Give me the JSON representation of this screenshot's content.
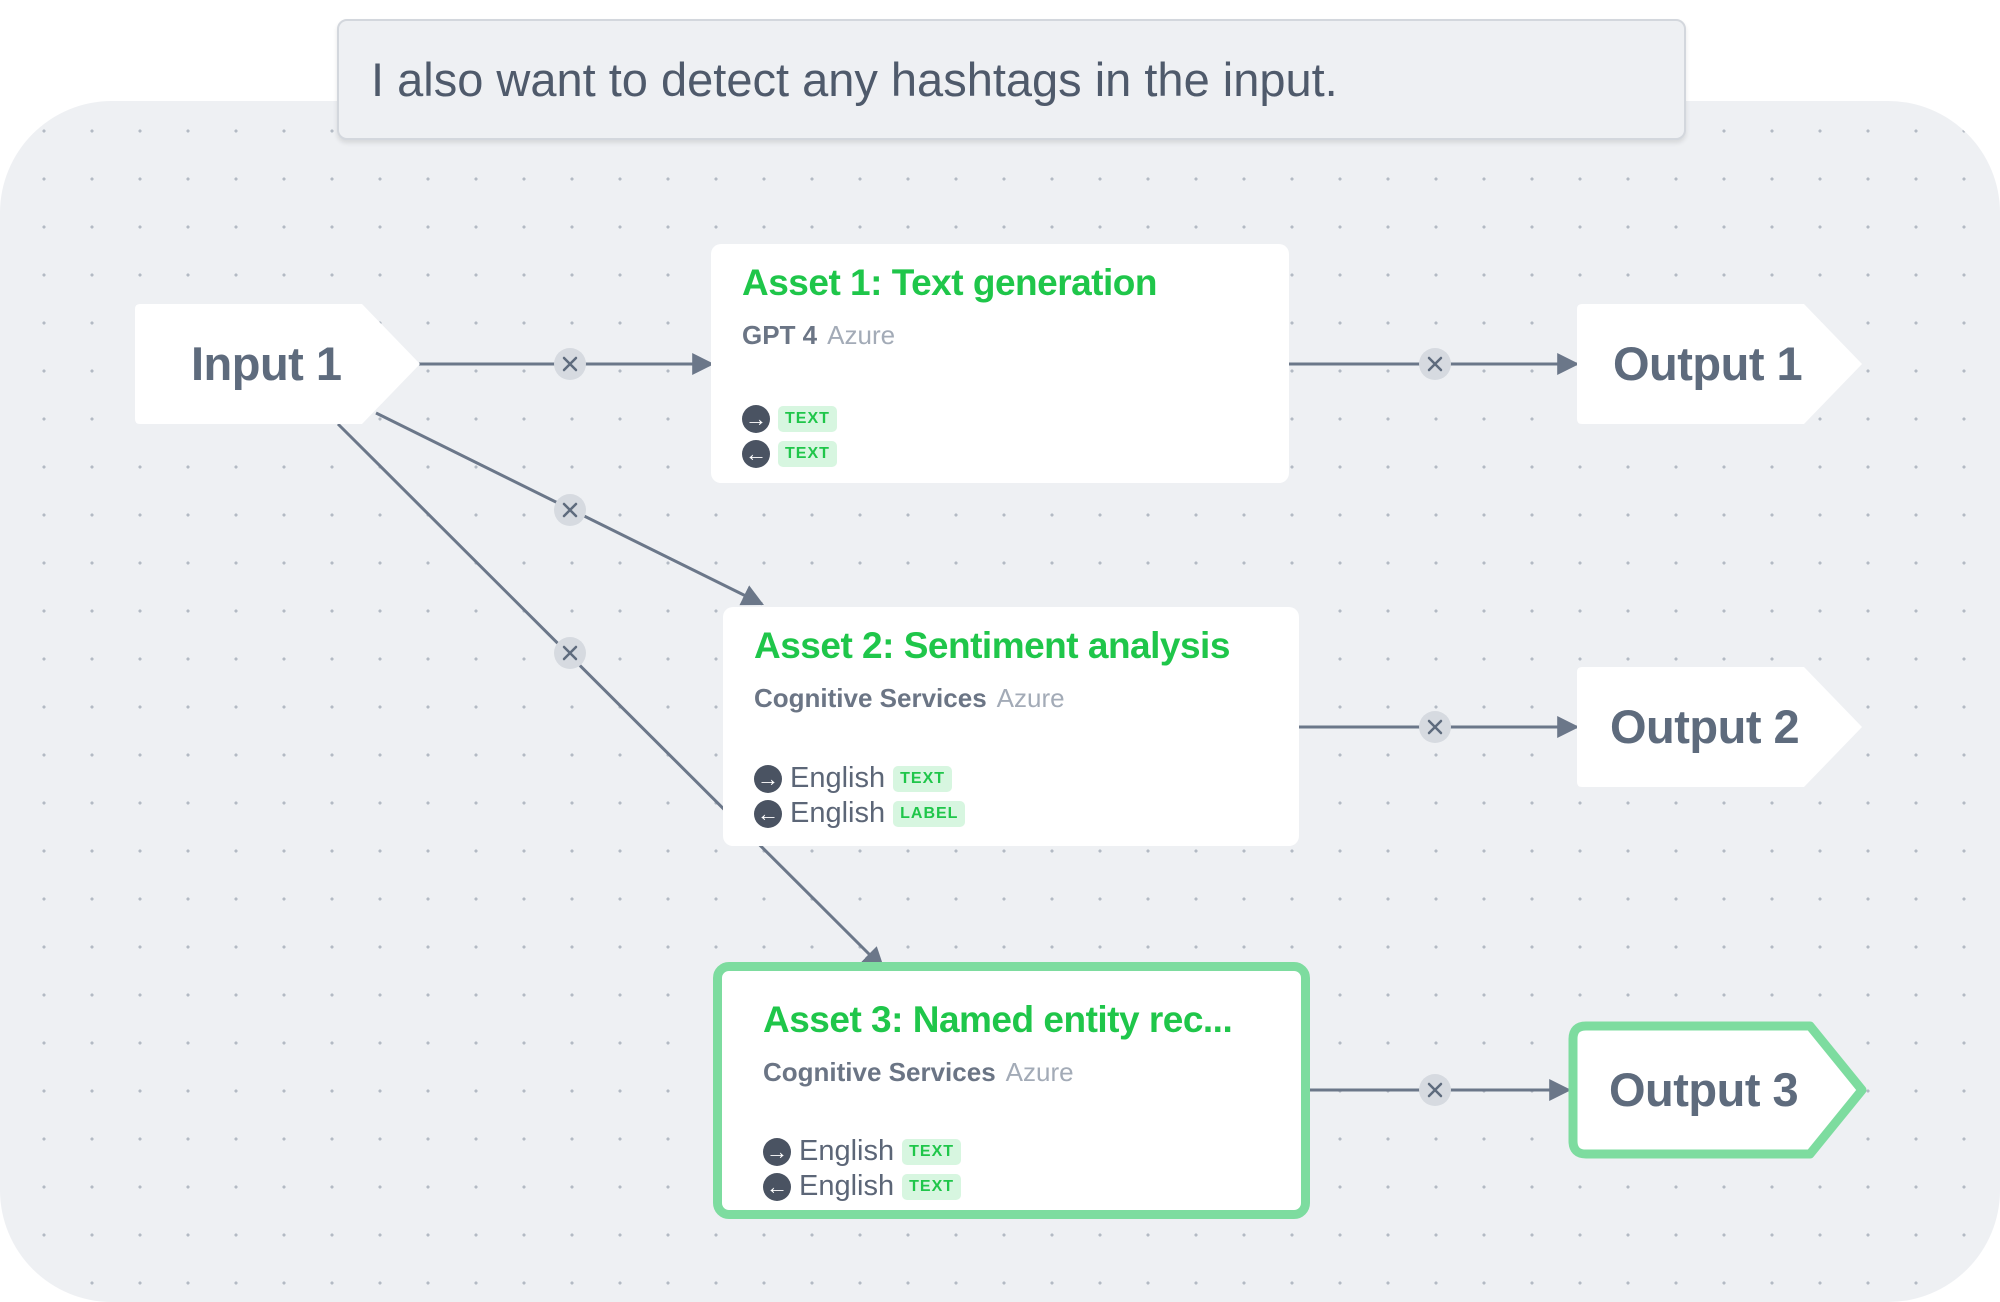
{
  "prompt": {
    "text": "I also want to detect any hashtags in the input."
  },
  "input": {
    "label": "Input 1"
  },
  "assets": [
    {
      "title": "Asset 1: Text generation",
      "provider": "GPT 4",
      "cloud": "Azure",
      "io": [
        {
          "direction": "in",
          "icon": "arrow-right-circle-icon",
          "language": "",
          "type": "TEXT"
        },
        {
          "direction": "out",
          "icon": "arrow-left-circle-icon",
          "language": "",
          "type": "TEXT"
        }
      ]
    },
    {
      "title": "Asset 2: Sentiment analysis",
      "provider": "Cognitive Services",
      "cloud": "Azure",
      "io": [
        {
          "direction": "in",
          "icon": "arrow-right-circle-icon",
          "language": "English",
          "type": "TEXT"
        },
        {
          "direction": "out",
          "icon": "arrow-left-circle-icon",
          "language": "English",
          "type": "LABEL"
        }
      ]
    },
    {
      "title": "Asset 3: Named entity rec...",
      "provider": "Cognitive Services",
      "cloud": "Azure",
      "selected": true,
      "io": [
        {
          "direction": "in",
          "icon": "arrow-right-circle-icon",
          "language": "English",
          "type": "TEXT"
        },
        {
          "direction": "out",
          "icon": "arrow-left-circle-icon",
          "language": "English",
          "type": "TEXT"
        }
      ]
    }
  ],
  "outputs": [
    {
      "label": "Output 1"
    },
    {
      "label": "Output 2"
    },
    {
      "label": "Output 3",
      "selected": true
    }
  ],
  "edge_delete_icon": "close-icon",
  "colors": {
    "accent_green": "#1fc64a",
    "selected_border": "#7ddc9f",
    "badge_bg": "#d7f6e0",
    "edge": "#6b7789",
    "canvas_bg": "#eef0f3"
  }
}
